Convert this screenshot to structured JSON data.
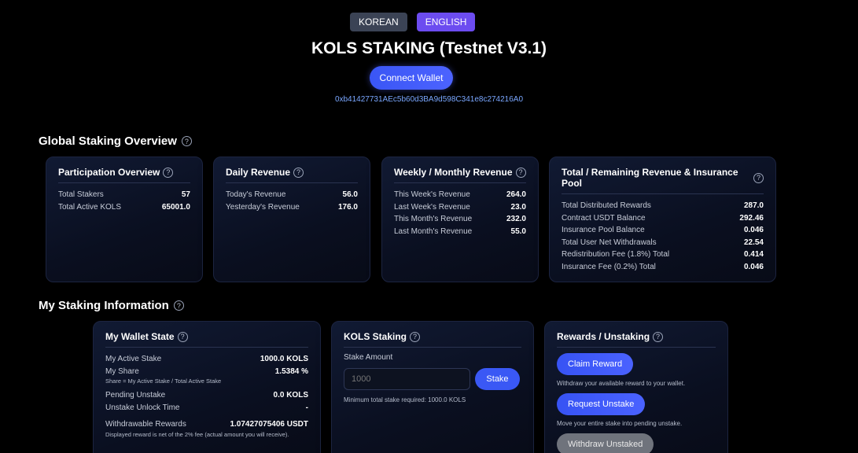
{
  "lang": {
    "korean": "KOREAN",
    "english": "ENGLISH"
  },
  "title": "KOLS STAKING (Testnet V3.1)",
  "connect_label": "Connect Wallet",
  "address": "0xb41427731AEc5b60d3BA9d598C341e8c274216A0",
  "help_glyph": "?",
  "global": {
    "title": "Global Staking Overview",
    "participation": {
      "title": "Participation Overview",
      "rows": [
        {
          "label": "Total Stakers",
          "value": "57"
        },
        {
          "label": "Total Active KOLS",
          "value": "65001.0"
        }
      ]
    },
    "daily": {
      "title": "Daily Revenue",
      "rows": [
        {
          "label": "Today's Revenue",
          "value": "56.0"
        },
        {
          "label": "Yesterday's Revenue",
          "value": "176.0"
        }
      ]
    },
    "weekly": {
      "title": "Weekly / Monthly Revenue",
      "rows": [
        {
          "label": "This Week's Revenue",
          "value": "264.0"
        },
        {
          "label": "Last Week's Revenue",
          "value": "23.0"
        },
        {
          "label": "This Month's Revenue",
          "value": "232.0"
        },
        {
          "label": "Last Month's Revenue",
          "value": "55.0"
        }
      ]
    },
    "total": {
      "title": "Total / Remaining Revenue & Insurance Pool",
      "rows": [
        {
          "label": "Total Distributed Rewards",
          "value": "287.0"
        },
        {
          "label": "Contract USDT Balance",
          "value": "292.46"
        },
        {
          "label": "Insurance Pool Balance",
          "value": "0.046"
        },
        {
          "label": "Total User Net Withdrawals",
          "value": "22.54"
        },
        {
          "label": "Redistribution Fee (1.8%) Total",
          "value": "0.414"
        },
        {
          "label": "Insurance Fee (0.2%) Total",
          "value": "0.046"
        }
      ]
    }
  },
  "mine": {
    "title": "My Staking Information",
    "wallet": {
      "title": "My Wallet State",
      "active_label": "My Active Stake",
      "active_value": "1000.0 KOLS",
      "share_label": "My Share",
      "share_value": "1.5384 %",
      "share_note": "Share = My Active Stake / Total Active Stake",
      "pending_label": "Pending Unstake",
      "pending_value": "0.0 KOLS",
      "unlock_label": "Unstake Unlock Time",
      "unlock_value": "-",
      "withdrawable_label": "Withdrawable Rewards",
      "withdrawable_value": "1.07427075406 USDT",
      "withdrawable_note": "Displayed reward is net of the 2% fee (actual amount you will receive)."
    },
    "staking": {
      "title": "KOLS Staking",
      "amount_label": "Stake Amount",
      "amount_placeholder": "1000",
      "stake_label": "Stake",
      "min_note": "Minimum total stake required: 1000.0 KOLS"
    },
    "rewards": {
      "title": "Rewards / Unstaking",
      "claim_label": "Claim Reward",
      "claim_note": "Withdraw your available reward to your wallet.",
      "request_label": "Request Unstake",
      "request_note": "Move your entire stake into pending unstake.",
      "withdraw_label": "Withdraw Unstaked"
    }
  }
}
